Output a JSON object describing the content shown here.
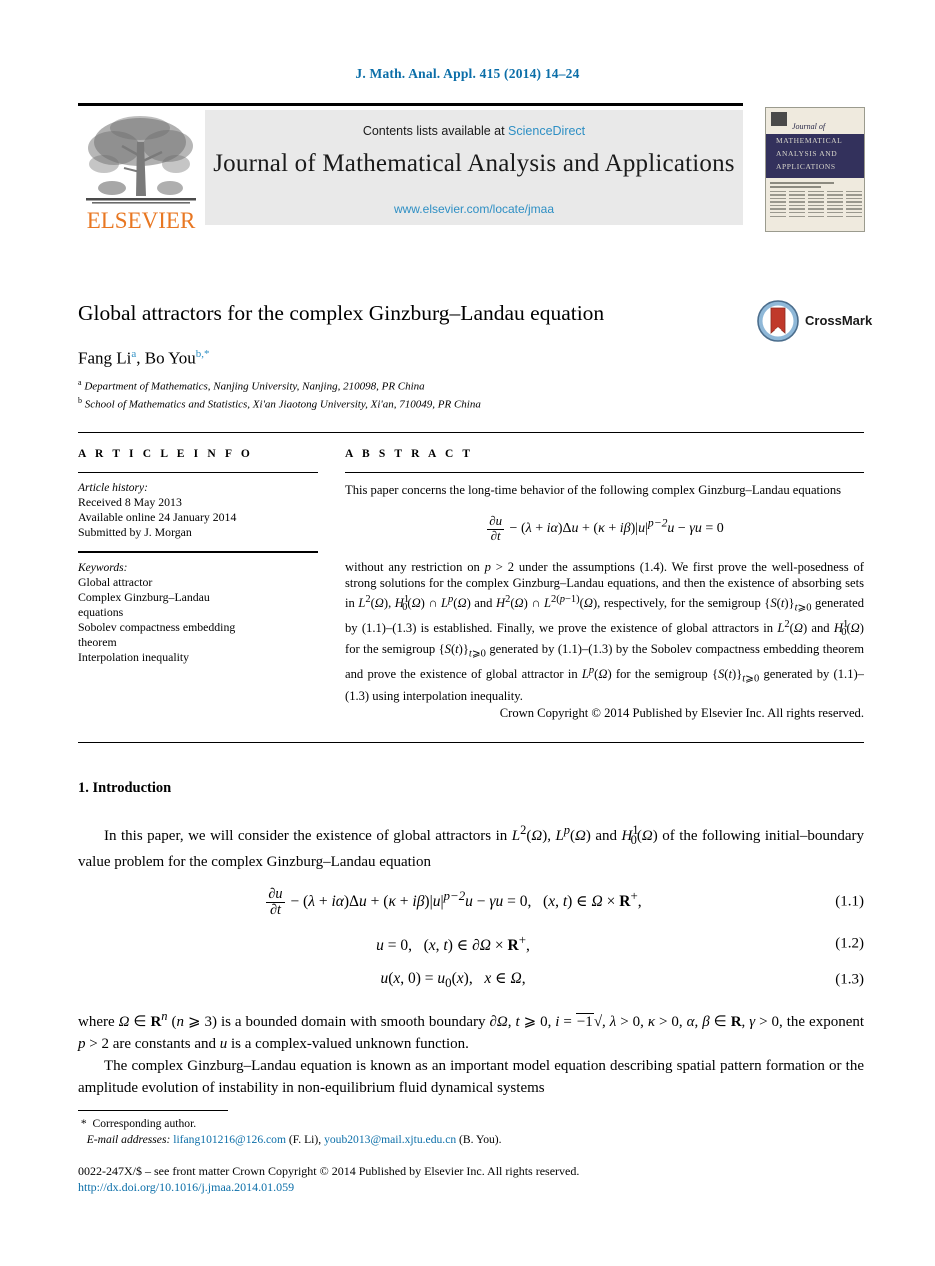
{
  "running_head": "J. Math. Anal. Appl. 415 (2014) 14–24",
  "masthead": {
    "contents_text": "Contents lists available at ",
    "sciencedirect": "ScienceDirect",
    "journal_title": "Journal of Mathematical Analysis and Applications",
    "journal_url": "www.elsevier.com/locate/jmaa",
    "publisher": "ELSEVIER",
    "cover": {
      "journal_of": "Journal of",
      "line1": "MATHEMATICAL",
      "line2": "ANALYSIS AND",
      "line3": "APPLICATIONS"
    }
  },
  "article": {
    "title": "Global attractors for the complex Ginzburg–Landau equation",
    "crossmark_label": "CrossMark",
    "authors": "Fang Li",
    "author_a_sup": "a",
    "authors_2": ", Bo You",
    "author_b_sup": "b,*",
    "affiliation_a": "Department of Mathematics, Nanjing University, Nanjing, 210098, PR China",
    "affiliation_b": "School of Mathematics and Statistics, Xi'an Jiaotong University, Xi'an, 710049, PR China",
    "affil_a_marker": "a",
    "affil_b_marker": "b"
  },
  "info": {
    "heading": "A R T I C L E    I N F O",
    "history_label": "Article history:",
    "received": "Received 8 May 2013",
    "available": "Available online 24 January 2014",
    "submitted": "Submitted by J. Morgan",
    "keywords_label": "Keywords:",
    "keywords": [
      "Global attractor",
      "Complex Ginzburg–Landau",
      "equations",
      "Sobolev compactness embedding",
      "theorem",
      "Interpolation inequality"
    ]
  },
  "abstract": {
    "heading": "A B S T R A C T",
    "para1": "This paper concerns the long-time behavior of the following complex Ginzburg–Landau equations",
    "para2_a": "without any restriction on ",
    "para2_b": " under the assumptions (1.4). We first prove the well-posedness of strong solutions for the complex Ginzburg–Landau equations, and then the existence of absorbing sets in ",
    "para2_c": ", respectively, for the semigroup ",
    "para2_d": " generated by (1.1)–(1.3) is established. Finally, we prove the existence of global attractors in ",
    "para2_e": " for the semigroup ",
    "para2_f": " generated by (1.1)–(1.3) by the Sobolev compactness embedding theorem and prove the existence of global attractor in ",
    "para2_g": " for the semigroup ",
    "para2_h": " generated by (1.1)–(1.3) using interpolation inequality.",
    "copyright": "Crown Copyright © 2014 Published by Elsevier Inc. All rights reserved."
  },
  "body": {
    "section_title": "1. Introduction",
    "para1_a": "In this paper, we will consider the existence of global attractors in ",
    "para1_b": " of the following initial–boundary value problem for the complex Ginzburg–Landau equation",
    "eq_numbers": [
      "(1.1)",
      "(1.2)",
      "(1.3)"
    ],
    "para2_a": "where ",
    "para2_b": " is a bounded domain with smooth boundary ",
    "para2_c": ", the exponent ",
    "para2_d": " are constants and ",
    "para2_e": " is a complex-valued unknown function.",
    "para3": "The complex Ginzburg–Landau equation is known as an important model equation describing spatial pattern formation or the amplitude evolution of instability in non-equilibrium fluid dynamical systems"
  },
  "footer": {
    "corresponding": "Corresponding author.",
    "email_label": "E-mail addresses:",
    "email1": "lifang101216@126.com",
    "email1_name": "(F. Li),",
    "email2": "youb2013@mail.xjtu.edu.cn",
    "email2_name": "(B. You).",
    "front_matter": "0022-247X/$ – see front matter  Crown Copyright © 2014 Published by Elsevier Inc. All rights reserved.",
    "doi": "http://dx.doi.org/10.1016/j.jmaa.2014.01.059"
  },
  "colors": {
    "link_blue": "#0b6ea8",
    "sd_blue": "#2e8fc4",
    "elsevier_orange": "#e87722",
    "cover_navy": "#33315c"
  }
}
